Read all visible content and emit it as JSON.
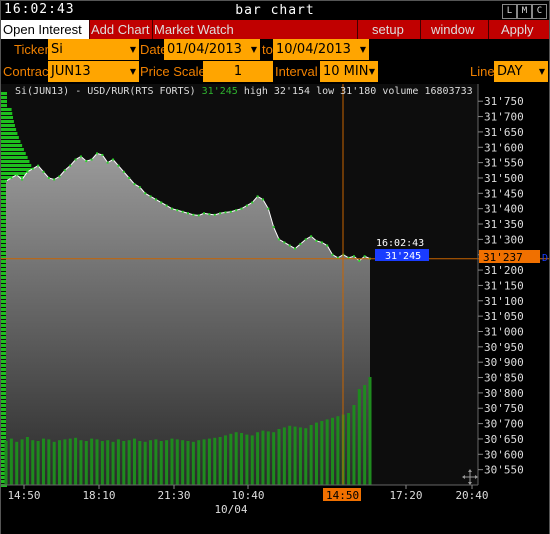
{
  "title": {
    "clock": "16:02:43",
    "window_title": "bar chart",
    "window_buttons": [
      "L",
      "M",
      "C"
    ]
  },
  "menu": {
    "tabs": [
      "Open Interest",
      "Add Chart",
      "Market Watch"
    ],
    "right": [
      "setup",
      "window",
      "Apply"
    ]
  },
  "controls": {
    "ticker_label": "Ticker",
    "ticker_value": "Si",
    "date_label": "Date",
    "date_from": "01/04/2013",
    "date_to_label": "to",
    "date_to": "10/04/2013",
    "contract_label": "Contract",
    "contract_value": "JUN13",
    "price_scale_label": "Price Scale",
    "price_scale_value": "1",
    "interval_label": "Interval",
    "interval_value": "10 MIN",
    "line_label": "Line",
    "line_value": "DAY"
  },
  "status": {
    "symbol": "Si(JUN13) - USD/RUR(RTS FORTS)",
    "last": "31'245",
    "high": "high 32'154",
    "low": "low 31'180",
    "volume": "volume 16803733"
  },
  "crosshair": {
    "time_label": "16:02:43",
    "price_tag": "31'245",
    "axis_price_tag": "31'237",
    "axis_time_tag": "14:50",
    "edge_marker": "D"
  },
  "colors": {
    "menu_bar": "#c00000",
    "field": "#ffa500",
    "label": "#f08000",
    "volume": "#1e8a1e",
    "profile": "#1fbf1f",
    "price_tag": "#1a3cff",
    "crosshair": "#c86400"
  },
  "chart_data": {
    "type": "area",
    "title": "Si(JUN13) - USD/RUR(RTS FORTS)",
    "ylim": [
      30500,
      31780
    ],
    "y_ticks": [
      "31'750",
      "31'700",
      "31'650",
      "31'600",
      "31'550",
      "31'500",
      "31'450",
      "31'400",
      "31'350",
      "31'300",
      "31'250",
      "31'200",
      "31'150",
      "31'100",
      "31'050",
      "31'000",
      "30'950",
      "30'900",
      "30'850",
      "30'800",
      "30'750",
      "30'700",
      "30'650",
      "30'600",
      "30'550"
    ],
    "x_ticks": [
      "14:50",
      "18:10",
      "21:30",
      "10:40",
      "14:50",
      "17:20",
      "20:40"
    ],
    "x_date_label": "10/04",
    "price": [
      31490,
      31500,
      31510,
      31495,
      31520,
      31530,
      31540,
      31520,
      31500,
      31495,
      31505,
      31525,
      31540,
      31560,
      31570,
      31555,
      31560,
      31580,
      31575,
      31550,
      31560,
      31540,
      31520,
      31500,
      31480,
      31470,
      31450,
      31440,
      31430,
      31420,
      31410,
      31400,
      31395,
      31390,
      31385,
      31380,
      31378,
      31385,
      31382,
      31380,
      31385,
      31388,
      31390,
      31395,
      31400,
      31410,
      31420,
      31440,
      31430,
      31400,
      31340,
      31300,
      31290,
      31280,
      31270,
      31285,
      31300,
      31310,
      31295,
      31290,
      31280,
      31250,
      31240,
      31250,
      31240,
      31245,
      31230,
      31245,
      31237
    ],
    "volume": [
      55,
      58,
      54,
      57,
      60,
      56,
      55,
      58,
      57,
      54,
      56,
      57,
      58,
      59,
      56,
      55,
      58,
      57,
      55,
      56,
      54,
      57,
      55,
      56,
      58,
      55,
      54,
      56,
      57,
      55,
      56,
      58,
      57,
      56,
      55,
      54,
      56,
      57,
      58,
      59,
      60,
      62,
      64,
      66,
      65,
      63,
      62,
      66,
      68,
      67,
      66,
      70,
      72,
      74,
      73,
      72,
      71,
      75,
      78,
      80,
      82,
      84,
      86,
      88,
      90,
      100,
      120,
      125,
      135
    ],
    "volume_ylim": [
      0,
      150
    ]
  }
}
